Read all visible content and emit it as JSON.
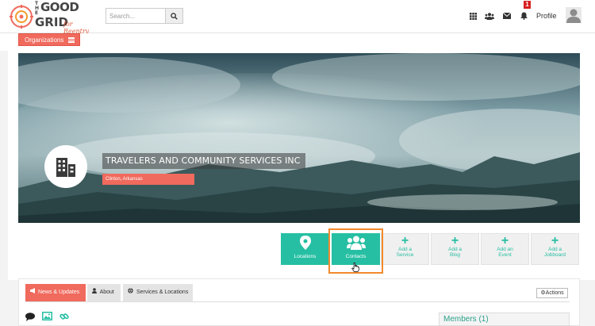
{
  "logo": {
    "line1": "THE",
    "line2": "GOOD",
    "line3": "GRID",
    "tagline": "for Reentry"
  },
  "search": {
    "placeholder": "Search..."
  },
  "header": {
    "notification_count": "1",
    "profile_label": "Profile"
  },
  "org_menu": {
    "label": "Organizations"
  },
  "organization": {
    "name": "TRAVELERS AND COMMUNITY SERVICES INC",
    "location": "Clinton, Arkansas"
  },
  "tiles": [
    {
      "label": "Locations"
    },
    {
      "label": "Contacts"
    },
    {
      "line1": "Add a",
      "line2": "Service"
    },
    {
      "line1": "Add a",
      "line2": "Blog"
    },
    {
      "line1": "Add an",
      "line2": "Event"
    },
    {
      "line1": "Add a",
      "line2": "Jobboard"
    }
  ],
  "tabs": [
    {
      "label": "News & Updates"
    },
    {
      "label": "About"
    },
    {
      "label": "Services & Locations"
    }
  ],
  "actions_label": "Actions",
  "members": {
    "label": "Members (1)"
  },
  "colors": {
    "accent": "#f06a5d",
    "teal": "#26bfa3",
    "highlight": "#f28a2e",
    "badge": "#d81e1e"
  },
  "icons": [
    "search-icon",
    "apps-grid-icon",
    "users-icon",
    "envelope-icon",
    "bell-icon",
    "user-avatar-icon",
    "hamburger-icon",
    "building-icon",
    "map-pin-icon",
    "contacts-icon",
    "plus-icon",
    "bullhorn-icon",
    "user-icon",
    "globe-icon",
    "gears-icon",
    "comment-icon",
    "photo-icon",
    "link-icon",
    "hand-cursor-icon"
  ]
}
